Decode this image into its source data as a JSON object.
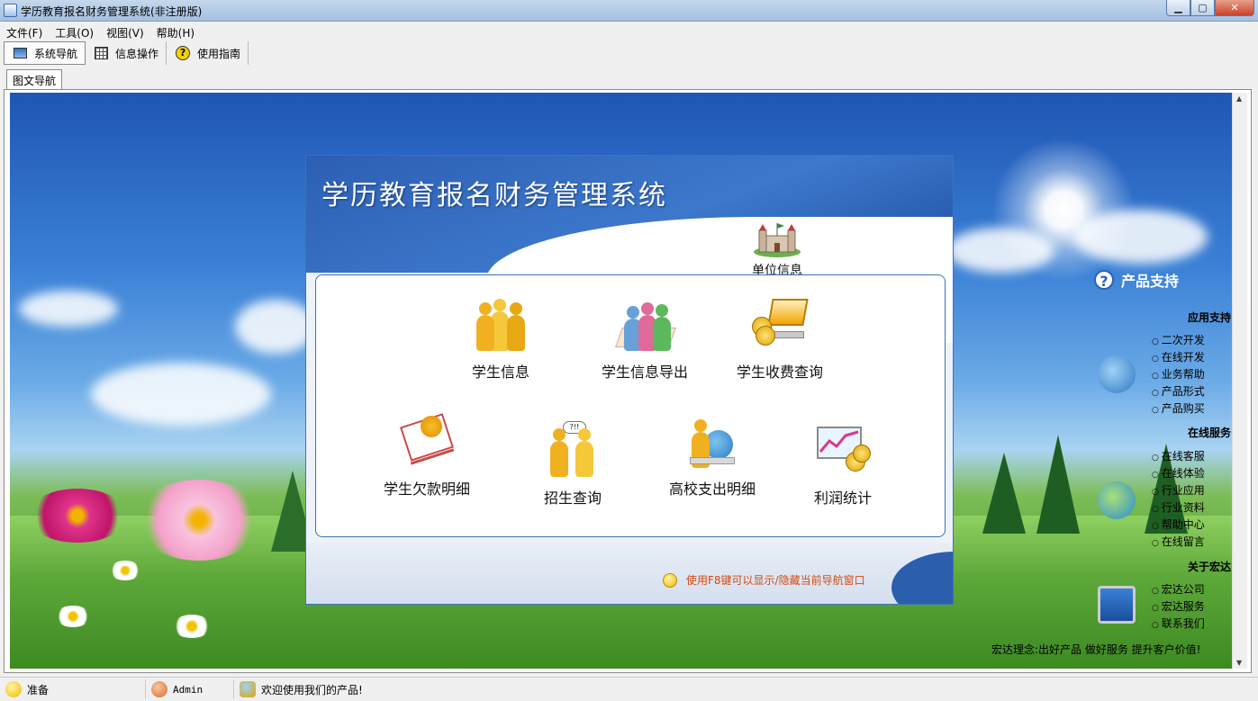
{
  "window": {
    "title": "学历教育报名财务管理系统(非注册版)",
    "buttons": [
      "minimize",
      "maximize",
      "close"
    ]
  },
  "menu": [
    "文件(F)",
    "工具(O)",
    "视图(V)",
    "帮助(H)"
  ],
  "toolbar": [
    {
      "label": "系统导航",
      "icon": "monitor-icon",
      "active": true
    },
    {
      "label": "信息操作",
      "icon": "grid-icon",
      "active": false
    },
    {
      "label": "使用指南",
      "icon": "help-icon",
      "active": false
    }
  ],
  "tab": {
    "label": "图文导航"
  },
  "panel": {
    "title": "学历教育报名财务管理系统",
    "org_info": "单位信息",
    "items": [
      {
        "label": "学生信息",
        "icon": "students-icon"
      },
      {
        "label": "学生信息导出",
        "icon": "export-icon"
      },
      {
        "label": "学生收费查询",
        "icon": "fee-query-icon"
      },
      {
        "label": "学生欠款明细",
        "icon": "debt-detail-icon"
      },
      {
        "label": "招生查询",
        "icon": "enrollment-query-icon"
      },
      {
        "label": "高校支出明细",
        "icon": "expense-detail-icon"
      },
      {
        "label": "利润统计",
        "icon": "profit-stats-icon"
      }
    ],
    "hint": "使用F8键可以显示/隐藏当前导航窗口"
  },
  "support": {
    "title": "产品支持",
    "sections": [
      {
        "heading": "应用支持",
        "items": [
          "二次开发",
          "在线开发",
          "业务帮助",
          "产品形式",
          "产品购买"
        ]
      },
      {
        "heading": "在线服务",
        "items": [
          "在线客服",
          "在线体验",
          "行业应用",
          "行业资料",
          "帮助中心",
          "在线留言"
        ]
      },
      {
        "heading": "关于宏达",
        "items": [
          "宏达公司",
          "宏达服务",
          "联系我们"
        ]
      }
    ],
    "motto": "宏达理念:出好产品 做好服务 提升客户价值!"
  },
  "status": {
    "ready": "准备",
    "user": "Admin",
    "welcome": "欢迎使用我们的产品!"
  }
}
